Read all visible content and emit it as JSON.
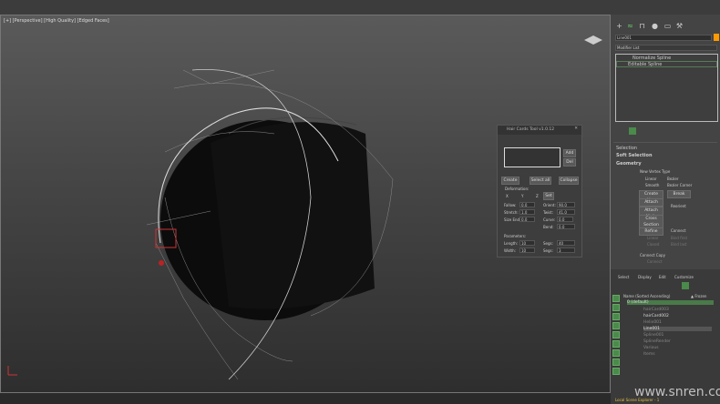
{
  "viewport": {
    "label": "[+] [Perspective] [High Quality] [Edged Faces]"
  },
  "dialog": {
    "title": "Hair Cards Tool v1.0.12",
    "add": "Add",
    "del": "Del",
    "create": "Create",
    "select_all": "Select all",
    "collapse": "Collapse",
    "deformation": "Deformation:",
    "axes": [
      "X",
      "Y",
      "Z"
    ],
    "set": "Set",
    "fields": [
      {
        "label": "Fallow:",
        "value": "0.0"
      },
      {
        "label": "Stretch:",
        "value": "1.0"
      },
      {
        "label": "Size End:",
        "value": "0.0"
      }
    ],
    "fields2": [
      {
        "label": "Orient:",
        "value": "90.0"
      },
      {
        "label": "Twist:",
        "value": "41.0"
      },
      {
        "label": "Curve:",
        "value": "0.0"
      },
      {
        "label": "Bend:",
        "value": "0.0"
      }
    ],
    "parameters": "Parameters:",
    "length": {
      "label": "Length:",
      "value": "10"
    },
    "width": {
      "label": "Width:",
      "value": "10"
    },
    "segs": {
      "label": "Segs:",
      "value": "40"
    },
    "segs2": {
      "label": "Segs:",
      "value": "3"
    }
  },
  "panel": {
    "object_name": "Line001",
    "modifier_list": "Modifier List",
    "modifiers": [
      "Normalize Spline",
      "Editable Spline"
    ],
    "rollouts": [
      "Selection",
      "Soft Selection",
      "Geometry"
    ],
    "new_vertex_type": "New Vertex Type",
    "vertex_types": [
      "Linear",
      "Bezier",
      "Smooth",
      "Bezier Corner"
    ],
    "buttons": [
      "Create Line",
      "Break",
      "Attach",
      "Attach Mult.",
      "Cross Section",
      "Refine"
    ],
    "reorient": "Reorient",
    "connect": "Connect",
    "linear": "Linear",
    "closed": "Closed",
    "bind_first": "Bind first",
    "bind_last": "Bind last",
    "connect_copy": "Connect Copy",
    "connect2": "Connect"
  },
  "explorer": {
    "menu": [
      "Select",
      "Display",
      "Edit",
      "Customize"
    ],
    "col_name": "Name (Sorted Ascending)",
    "col_frozen": "▲ Frozen",
    "items": [
      "0 (default)",
      "hairCard003",
      "hairCard002",
      "Helix001",
      "Line001",
      "Spline001",
      "SplineRender",
      "Various",
      "Items"
    ],
    "footer": "Local Scene Explorer - 1"
  },
  "watermark": "www.snren.com"
}
